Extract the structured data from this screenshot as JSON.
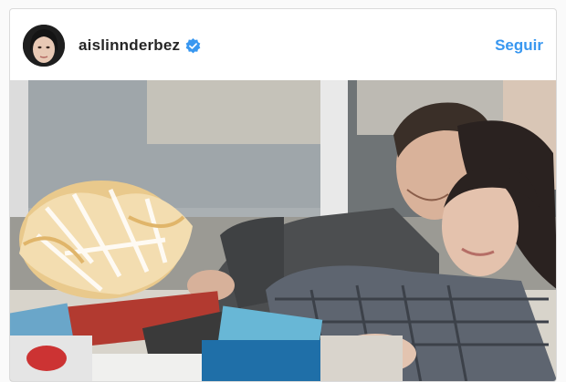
{
  "post": {
    "username": "aislinnderbez",
    "verified_icon": "verified-badge-icon",
    "follow_label": "Seguir",
    "accent_color": "#3897f0",
    "photo_icon": "post-photo"
  }
}
